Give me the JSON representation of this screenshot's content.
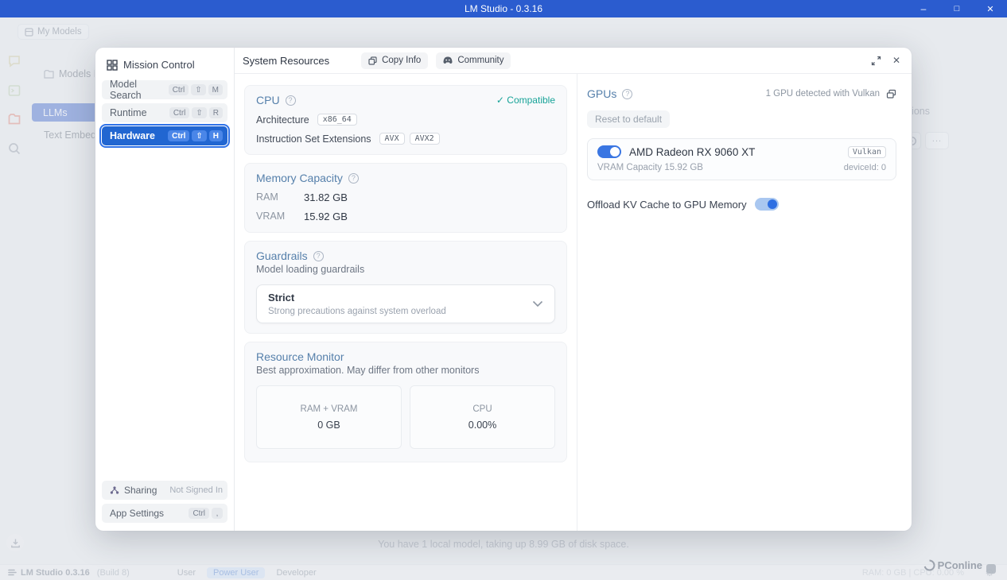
{
  "window": {
    "title": "LM Studio - 0.3.16"
  },
  "background": {
    "my_models": "My Models",
    "models_dir": "Models Dir",
    "llms": "LLMs",
    "text_embedding": "Text Embedding",
    "actions_col": "Actions",
    "more_button": "...",
    "status_line": "You have 1 local model, taking up 8.99 GB of disk space.",
    "statusbar": {
      "app_name": "LM Studio 0.3.16",
      "build": "(Build 8)",
      "mode_user": "User",
      "mode_power_user": "Power User",
      "mode_developer": "Developer",
      "stats": "RAM: 0 GB  |  CPU: 0.00 %"
    },
    "watermark": "PConline"
  },
  "dialog": {
    "sidebar": {
      "title": "Mission Control",
      "items": [
        {
          "label": "Model Search",
          "keys": [
            "Ctrl",
            "⇧",
            "M"
          ]
        },
        {
          "label": "Runtime",
          "keys": [
            "Ctrl",
            "⇧",
            "R"
          ]
        },
        {
          "label": "Hardware",
          "keys": [
            "Ctrl",
            "⇧",
            "H"
          ]
        }
      ],
      "sharing": {
        "label": "Sharing",
        "status": "Not Signed In"
      },
      "app_settings": {
        "label": "App Settings",
        "keys": [
          "Ctrl",
          ","
        ]
      }
    },
    "header": {
      "title": "System Resources",
      "copy_info": "Copy Info",
      "community": "Community"
    },
    "cpu": {
      "title": "CPU",
      "compatible": "✓ Compatible",
      "architecture_label": "Architecture",
      "architecture": "x86_64",
      "instructions_label": "Instruction Set Extensions",
      "instructions": [
        "AVX",
        "AVX2"
      ]
    },
    "memory": {
      "title": "Memory Capacity",
      "ram_label": "RAM",
      "ram": "31.82 GB",
      "vram_label": "VRAM",
      "vram": "15.92 GB"
    },
    "guardrails": {
      "title": "Guardrails",
      "subtitle": "Model loading guardrails",
      "selected": "Strict",
      "selected_desc": "Strong precautions against system overload"
    },
    "resource_monitor": {
      "title": "Resource Monitor",
      "subtitle": "Best approximation. May differ from other monitors",
      "ram_vram_label": "RAM + VRAM",
      "ram_vram_value": "0 GB",
      "cpu_label": "CPU",
      "cpu_value": "0.00%"
    },
    "gpus": {
      "title": "GPUs",
      "detected": "1 GPU detected with Vulkan",
      "reset": "Reset to default",
      "gpu_name": "AMD Radeon RX 9060 XT",
      "api_badge": "Vulkan",
      "vram_capacity": "VRAM Capacity 15.92 GB",
      "device_id": "deviceId: 0",
      "offload_label": "Offload KV Cache to GPU Memory"
    }
  }
}
